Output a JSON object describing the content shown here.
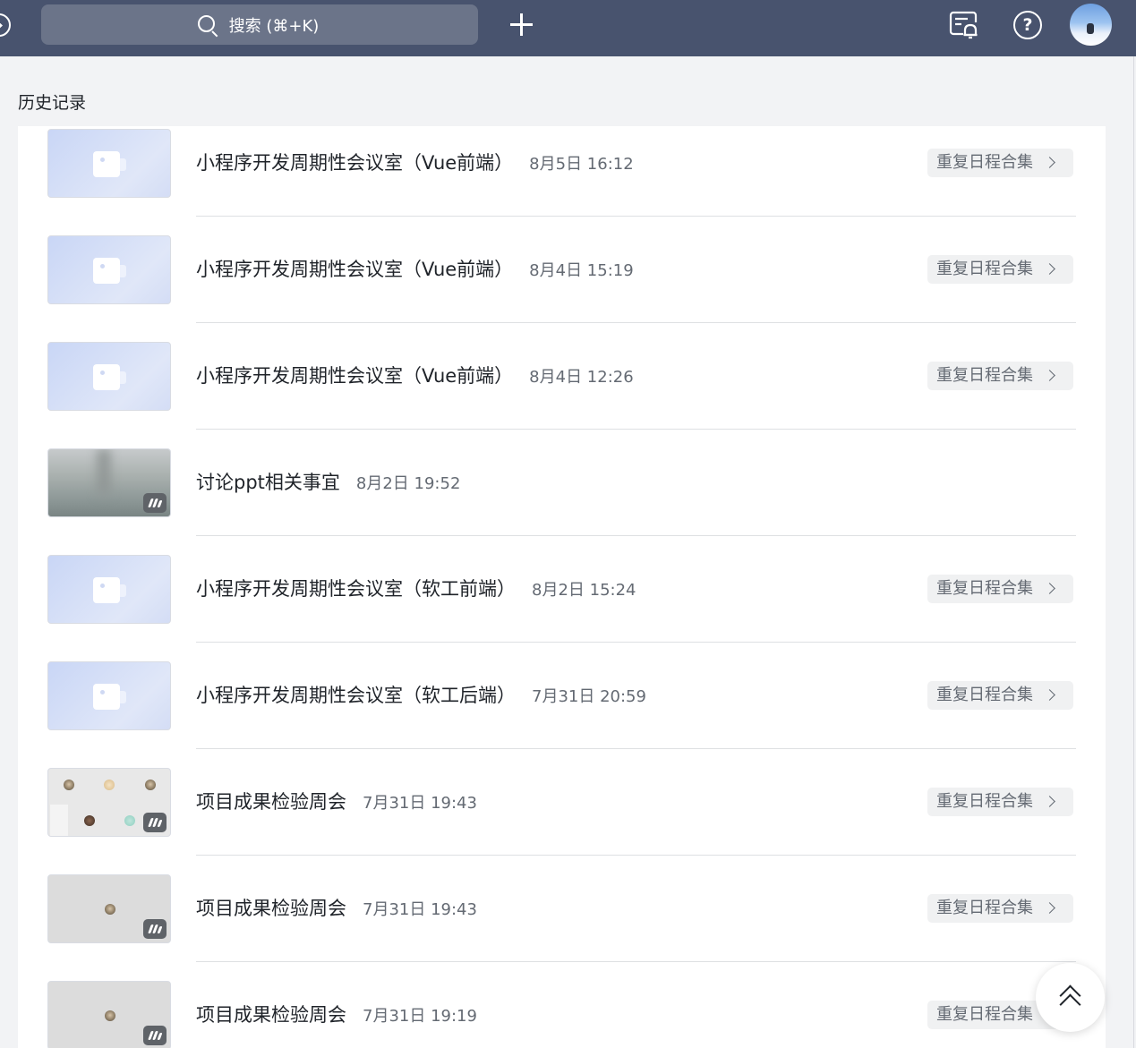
{
  "topbar": {
    "search_placeholder": "搜索 (⌘+K)",
    "icons": [
      "back-icon",
      "search-icon",
      "plus-icon",
      "notification-icon",
      "help-icon",
      "avatar"
    ]
  },
  "page": {
    "title": "历史记录"
  },
  "colors": {
    "topbar_bg": "#48536e",
    "search_bg": "#6b7489",
    "page_bg": "#f2f3f5",
    "panel_bg": "#ffffff",
    "button_bg": "#f0f1f2"
  },
  "meetings": [
    {
      "title": "小程序开发周期性会议室（Vue前端）",
      "time": "8月5日 16:12",
      "series_label": "重复日程合集",
      "thumb": "video"
    },
    {
      "title": "小程序开发周期性会议室（Vue前端）",
      "time": "8月4日 15:19",
      "series_label": "重复日程合集",
      "thumb": "video"
    },
    {
      "title": "小程序开发周期性会议室（Vue前端）",
      "time": "8月4日 12:26",
      "series_label": "重复日程合集",
      "thumb": "video"
    },
    {
      "title": "讨论ppt相关事宜",
      "time": "8月2日 19:52",
      "series_label": "",
      "thumb": "blur"
    },
    {
      "title": "小程序开发周期性会议室（软工前端）",
      "time": "8月2日 15:24",
      "series_label": "重复日程合集",
      "thumb": "video"
    },
    {
      "title": "小程序开发周期性会议室（软工后端）",
      "time": "7月31日 20:59",
      "series_label": "重复日程合集",
      "thumb": "video"
    },
    {
      "title": "项目成果检验周会",
      "time": "7月31日 19:43",
      "series_label": "重复日程合集",
      "thumb": "grid"
    },
    {
      "title": "项目成果检验周会",
      "time": "7月31日 19:43",
      "series_label": "重复日程合集",
      "thumb": "grey"
    },
    {
      "title": "项目成果检验周会",
      "time": "7月31日 19:19",
      "series_label": "重复日程合集",
      "thumb": "grey"
    }
  ],
  "back_to_top": {
    "icon": "double-chevron-up-icon"
  }
}
